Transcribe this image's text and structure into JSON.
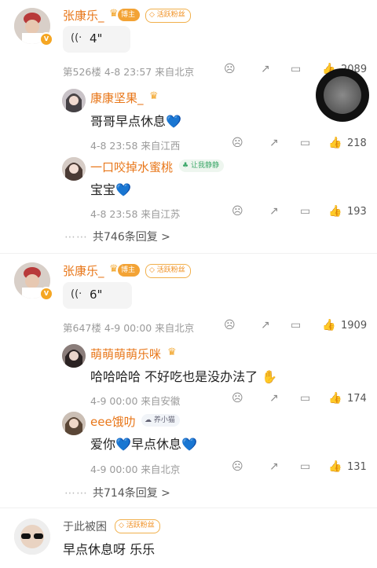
{
  "comments": [
    {
      "user": "张康乐_",
      "tags": [
        "博主",
        "活跃粉丝"
      ],
      "voice_duration": "4\"",
      "floor": "第526楼",
      "datetime": "4-8 23:57",
      "location": "来自北京",
      "likes": "2089",
      "replies": [
        {
          "user": "康康坚果_",
          "text": "哥哥早点休息💙",
          "datetime": "4-8 23:58",
          "location": "来自江西",
          "likes": "218"
        },
        {
          "user": "一口咬掉水蜜桃",
          "tag": "让我静静",
          "text": "宝宝💙",
          "datetime": "4-8 23:58",
          "location": "来自江苏",
          "likes": "193"
        }
      ],
      "more_replies": "共746条回复 >"
    },
    {
      "user": "张康乐_",
      "tags": [
        "博主",
        "活跃粉丝"
      ],
      "voice_duration": "6\"",
      "floor": "第647楼",
      "datetime": "4-9 00:00",
      "location": "来自北京",
      "likes": "1909",
      "replies": [
        {
          "user": "萌萌萌萌乐咪",
          "text": "哈哈哈哈 不好吃也是没办法了",
          "datetime": "4-9 00:00",
          "location": "来自安徽",
          "likes": "174"
        },
        {
          "user": "eee饿叻",
          "tag": "养小猫",
          "text": "爱你💙早点休息💙",
          "datetime": "4-9 00:00",
          "location": "来自北京",
          "likes": "131"
        }
      ],
      "more_replies": "共714条回复 >"
    },
    {
      "user": "于此被困",
      "tags": [
        "活跃粉丝"
      ],
      "text": "早点休息呀 乐乐"
    }
  ],
  "icons": {
    "voice": "((·",
    "sad": "☹",
    "share": "↗",
    "comment": "▭",
    "like": "👍",
    "crown": "♛",
    "dots": "⋯⋯"
  },
  "colors": {
    "username": "#e8771a",
    "heart": "#1e6fd9",
    "meta": "#9a9a9a"
  }
}
